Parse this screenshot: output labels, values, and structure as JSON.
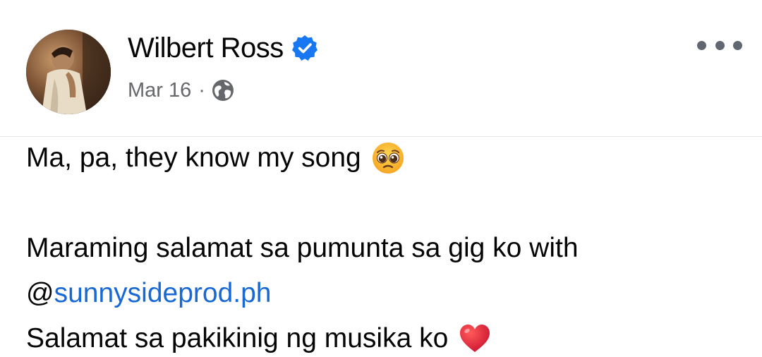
{
  "post": {
    "author": "Wilbert Ross",
    "date": "Mar 16",
    "separator": "·",
    "audience_icon": "globe-icon",
    "verified_icon": "verified-badge-icon",
    "more_icon": "more-options-icon",
    "lines": {
      "line1": "Ma, pa, they know my song",
      "line1_emoji": "pleading-face-emoji",
      "line2": "Maraming salamat sa pumunta sa gig ko with",
      "mention_prefix": "@",
      "mention": "sunnysideprod.ph",
      "line4": "Salamat sa pakikinig ng musika ko",
      "line4_emoji": "red-heart-emoji"
    }
  },
  "colors": {
    "text": "#050505",
    "secondary": "#65676b",
    "link": "#1869d6",
    "verified": "#1877f2",
    "divider": "#e4e6eb"
  }
}
